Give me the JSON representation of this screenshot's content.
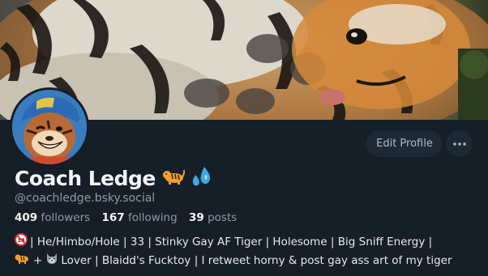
{
  "profile": {
    "display_name": "Coach Ledge",
    "name_emojis": [
      "tiger-emoji",
      "sweat-droplets-emoji"
    ],
    "handle": "@coachledge.bsky.social",
    "stats": {
      "followers_count": "409",
      "followers_label": "followers",
      "following_count": "167",
      "following_label": "following",
      "posts_count": "39",
      "posts_label": "posts"
    },
    "bio": {
      "line1_icon": "no-under-18-icon",
      "line1_text": "| He/Himbo/Hole | 33 | Stinky Gay AF Tiger | Holesome | Big Sniff Energy |",
      "line2_icons": [
        "tiger-icon",
        "wolf-icon"
      ],
      "line2_plus": "+",
      "line2_text": "Lover | Blaidd's Fucktoy | I retweet horny & post gay ass art of my tiger"
    }
  },
  "actions": {
    "edit_profile_label": "Edit Profile",
    "more_icon": "ellipsis-icon"
  },
  "colors": {
    "background": "#161e27",
    "button_bg": "#1e2936",
    "text_primary": "#f1f3f5",
    "text_secondary": "#8c9aab"
  }
}
